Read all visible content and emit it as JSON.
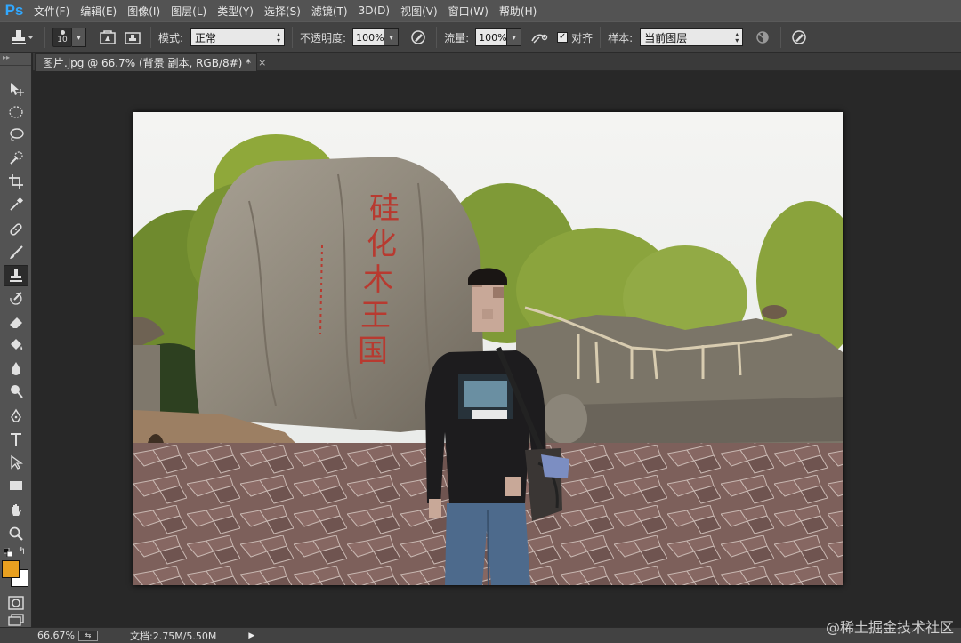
{
  "app": {
    "logo": "Ps",
    "accent": "#31a8ff"
  },
  "menu": [
    "文件(F)",
    "编辑(E)",
    "图像(I)",
    "图层(L)",
    "类型(Y)",
    "选择(S)",
    "滤镜(T)",
    "3D(D)",
    "视图(V)",
    "窗口(W)",
    "帮助(H)"
  ],
  "options": {
    "brush_size": "10",
    "mode_label": "模式:",
    "mode_value": "正常",
    "opacity_label": "不透明度:",
    "opacity_value": "100%",
    "flow_label": "流量:",
    "flow_value": "100%",
    "align_label": "对齐",
    "align_checked": true,
    "sample_label": "样本:",
    "sample_value": "当前图层"
  },
  "document": {
    "tab_title": "图片.jpg @ 66.7% (背景 副本, RGB/8#) *",
    "close_glyph": "×"
  },
  "photo": {
    "stone_inscription": "硅化木王国"
  },
  "status": {
    "zoom": "66.67%",
    "doc_info": "文档:2.75M/5.50M"
  },
  "colors": {
    "foreground": "#e8a020",
    "background": "#ffffff"
  },
  "watermark": "@稀土掘金技术社区"
}
